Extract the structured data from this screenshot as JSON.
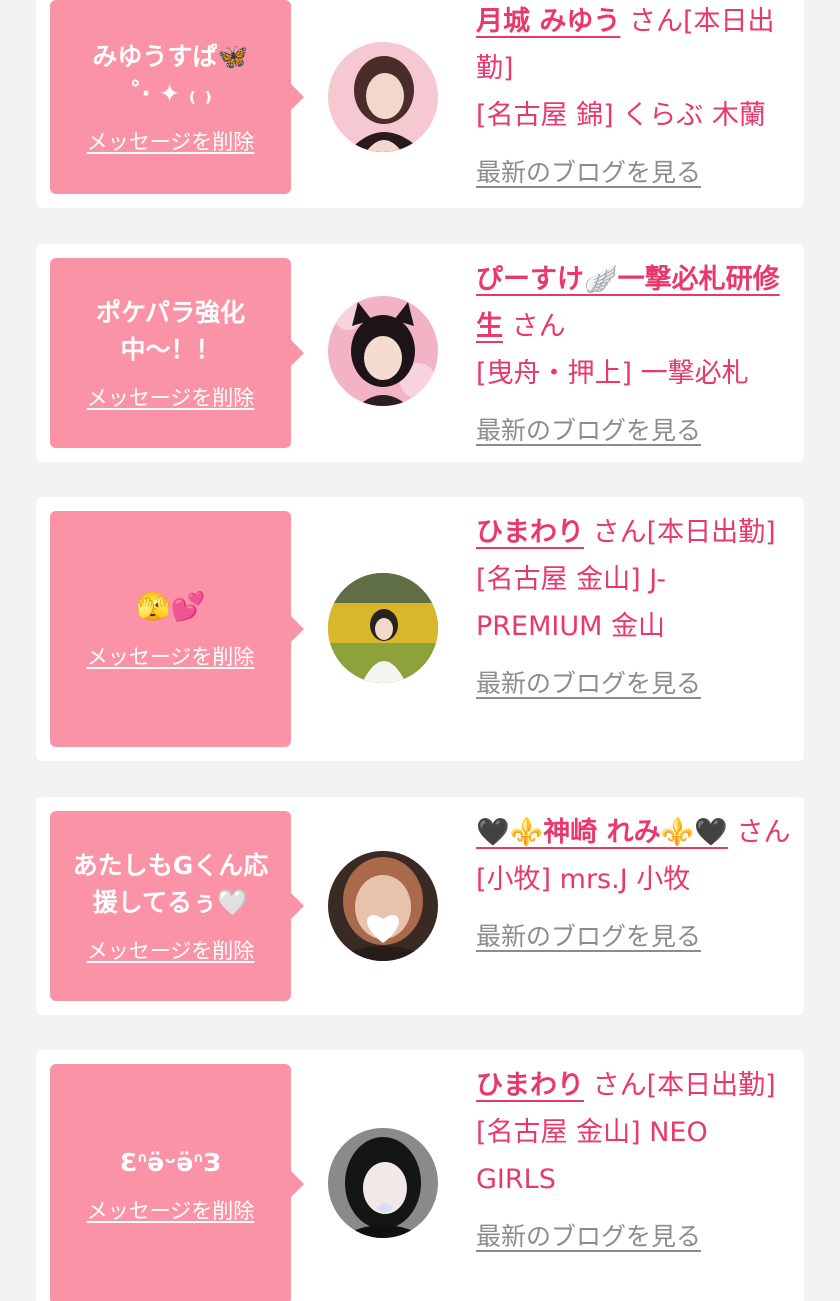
{
  "delete_label": "メッセージを削除",
  "blog_label": "最新のブログを見る",
  "san": "さん",
  "colors": {
    "accent": "#e8386c",
    "bubble": "#fb93a6",
    "link_gray": "#8c8c8c",
    "background": "#f2f2f2"
  },
  "cards": [
    {
      "message": "みゆうすぱ🦋\n˚‧ ✦ ₍ ₎",
      "name": "月城 みゆう",
      "status": "[本日出勤]",
      "shop": "[名古屋 錦] くらぶ 木蘭"
    },
    {
      "message": "ポケパラ強化\n中〜！！",
      "name": "ぴーすけ🪽一撃必札研修生",
      "status": "",
      "shop": "[曳舟・押上] 一撃必札"
    },
    {
      "message": "🫣💕",
      "name": "ひまわり",
      "status": "[本日出勤]",
      "shop": "[名古屋 金山] J-PREMIUM 金山"
    },
    {
      "message": "あたしもGくん応\n援してるぅ🤍",
      "name": "🖤⚜️神崎 れみ⚜️🖤",
      "status": "",
      "shop": "[小牧] mrs.J 小牧"
    },
    {
      "message": "ƐᐢӛᵕӛᐢЗ",
      "name": "ひまわり",
      "status": "[本日出勤]",
      "shop": "[名古屋 金山] NEO GIRLS"
    }
  ]
}
